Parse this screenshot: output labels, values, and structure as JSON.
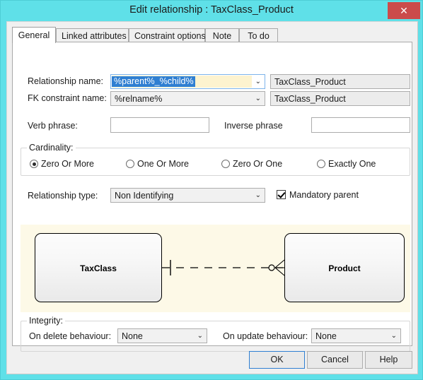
{
  "window": {
    "title": "Edit relationship : TaxClass_Product",
    "close_label": "✕",
    "titlebar_color": "#5fe0e8",
    "close_button_color": "#cb4b4b"
  },
  "tabs": [
    {
      "label": "General",
      "active": true
    },
    {
      "label": "Linked attributes",
      "active": false
    },
    {
      "label": "Constraint options",
      "active": false
    },
    {
      "label": "Note",
      "active": false
    },
    {
      "label": "To do",
      "active": false
    }
  ],
  "form": {
    "relationship_name_label": "Relationship name:",
    "relationship_name_value": "%parent%_%child%",
    "relationship_name_resolved": "TaxClass_Product",
    "fk_constraint_label": "FK constraint name:",
    "fk_constraint_value": "%relname%",
    "fk_constraint_resolved": "TaxClass_Product",
    "verb_phrase_label": "Verb phrase:",
    "verb_phrase_value": "",
    "inverse_phrase_label": "Inverse phrase",
    "inverse_phrase_value": "",
    "relationship_type_label": "Relationship type:",
    "relationship_type_value": "Non Identifying",
    "mandatory_parent_label": "Mandatory parent",
    "mandatory_parent_checked": true,
    "dropdown_arrow": "⌄"
  },
  "cardinality": {
    "title": "Cardinality:",
    "options": [
      {
        "label": "Zero Or More",
        "checked": true
      },
      {
        "label": "One Or More",
        "checked": false
      },
      {
        "label": "Zero Or One",
        "checked": false
      },
      {
        "label": "Exactly One",
        "checked": false
      }
    ]
  },
  "diagram": {
    "parent_entity": "TaxClass",
    "child_entity": "Product",
    "background_color": "#fdf9e7",
    "line_style": "dashed",
    "parent_end_notation": "one",
    "child_end_notation": "zero-or-more"
  },
  "integrity": {
    "title": "Integrity:",
    "on_delete_label": "On delete behaviour:",
    "on_delete_value": "None",
    "on_update_label": "On update behaviour:",
    "on_update_value": "None"
  },
  "buttons": {
    "ok": "OK",
    "cancel": "Cancel",
    "help": "Help"
  }
}
